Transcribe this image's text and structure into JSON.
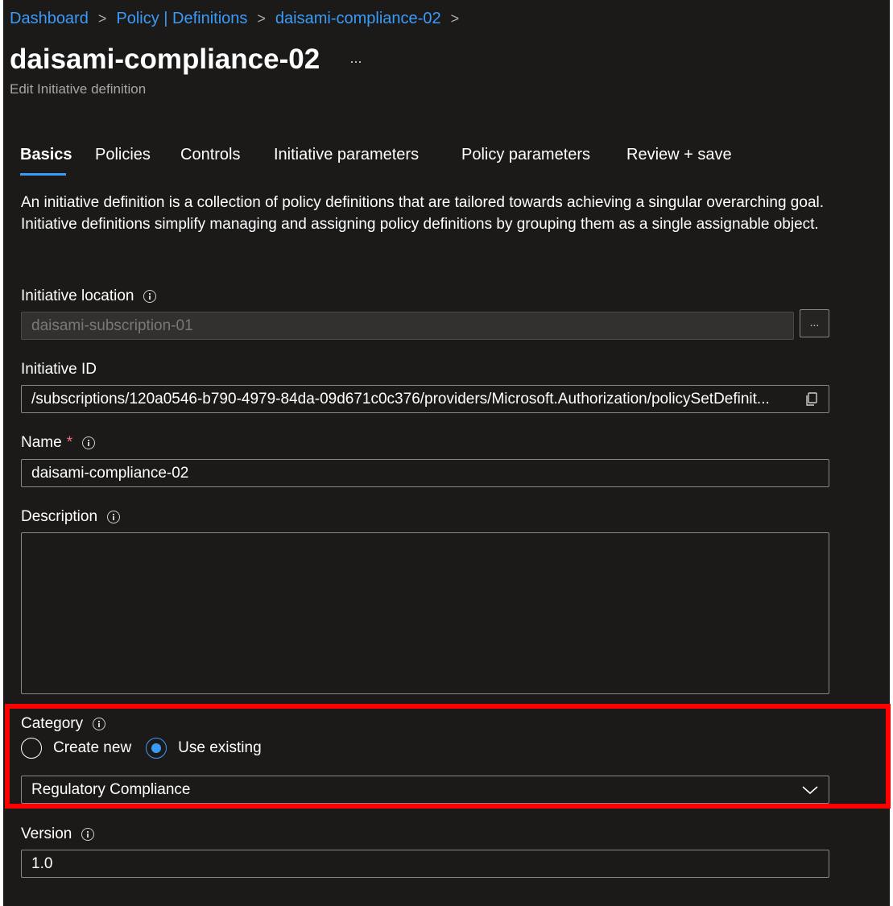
{
  "breadcrumb": {
    "items": [
      "Dashboard",
      "Policy | Definitions",
      "daisami-compliance-02"
    ],
    "separator": ">"
  },
  "header": {
    "title": "daisami-compliance-02",
    "more": "...",
    "subtitle": "Edit Initiative definition"
  },
  "tabs": [
    {
      "label": "Basics",
      "active": true
    },
    {
      "label": "Policies"
    },
    {
      "label": "Controls"
    },
    {
      "label": "Initiative parameters"
    },
    {
      "label": "Policy parameters"
    },
    {
      "label": "Review + save"
    }
  ],
  "intro": "An initiative definition is a collection of policy definitions that are tailored towards achieving a singular overarching goal. Initiative definitions simplify managing and assigning policy definitions by grouping them as a single assignable object.",
  "form": {
    "location": {
      "label": "Initiative location",
      "value": "daisami-subscription-01",
      "browse": "..."
    },
    "id": {
      "label": "Initiative ID",
      "value": "/subscriptions/120a0546-b790-4979-84da-09d671c0c376/providers/Microsoft.Authorization/policySetDefinit..."
    },
    "name": {
      "label": "Name",
      "required_mark": "*",
      "value": "daisami-compliance-02"
    },
    "description": {
      "label": "Description",
      "value": ""
    },
    "category": {
      "label": "Category",
      "options": [
        "Create new",
        "Use existing"
      ],
      "selected": "Use existing",
      "value": "Regulatory Compliance"
    },
    "version": {
      "label": "Version",
      "value": "1.0"
    }
  },
  "colors": {
    "background": "#1b1a19",
    "link": "#3a9bfa",
    "highlight": "#ff0000",
    "required": "#f1707b"
  }
}
